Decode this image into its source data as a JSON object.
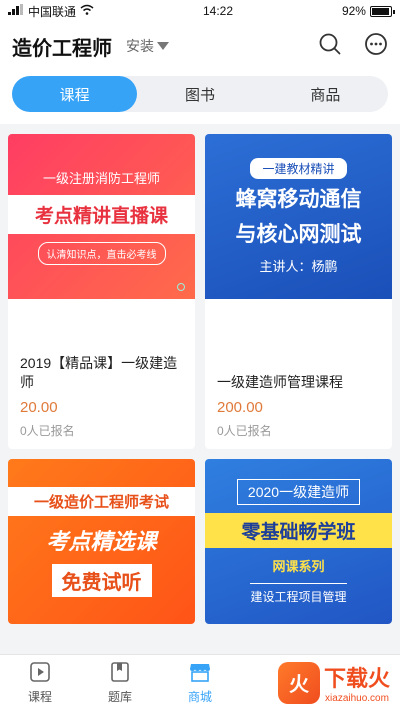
{
  "status_bar": {
    "carrier": "中国联通",
    "time": "14:22",
    "battery": "92%",
    "battery_level": 0.92
  },
  "header": {
    "title": "造价工程师",
    "install_label": "安装"
  },
  "tabs": [
    {
      "label": "课程",
      "active": true
    },
    {
      "label": "图书",
      "active": false
    },
    {
      "label": "商品",
      "active": false
    }
  ],
  "courses": [
    {
      "thumb": {
        "sub": "一级注册消防工程师",
        "main": "考点精讲直播课",
        "tag": "认清知识点，直击必考线"
      },
      "title": "2019【精品课】一级建造师",
      "price": "20.00",
      "enrolled": "0人已报名"
    },
    {
      "thumb": {
        "pill": "一建教材精讲",
        "line1": "蜂窝移动通信",
        "line2": "与核心网测试",
        "host": "主讲人：杨鹏"
      },
      "title": "一级建造师管理课程",
      "price": "200.00",
      "enrolled": "0人已报名"
    },
    {
      "thumb": {
        "banner": "一级造价工程师考试",
        "line1": "考点精选课",
        "line2": "免费试听"
      }
    },
    {
      "thumb": {
        "year": "2020一级建造师",
        "line1": "零基础畅学班",
        "series": "网课系列",
        "subject": "建设工程项目管理"
      }
    }
  ],
  "bottom_nav": [
    {
      "label": "课程",
      "icon": "play-icon",
      "active": false
    },
    {
      "label": "题库",
      "icon": "book-icon",
      "active": false
    },
    {
      "label": "商城",
      "icon": "store-icon",
      "active": true
    }
  ],
  "brand": {
    "logo_text": "火",
    "name": "下载火",
    "url": "xiazaihuo.com"
  },
  "colors": {
    "accent": "#36a3f7",
    "price": "#e07a3a",
    "brand": "#f04d1f"
  }
}
